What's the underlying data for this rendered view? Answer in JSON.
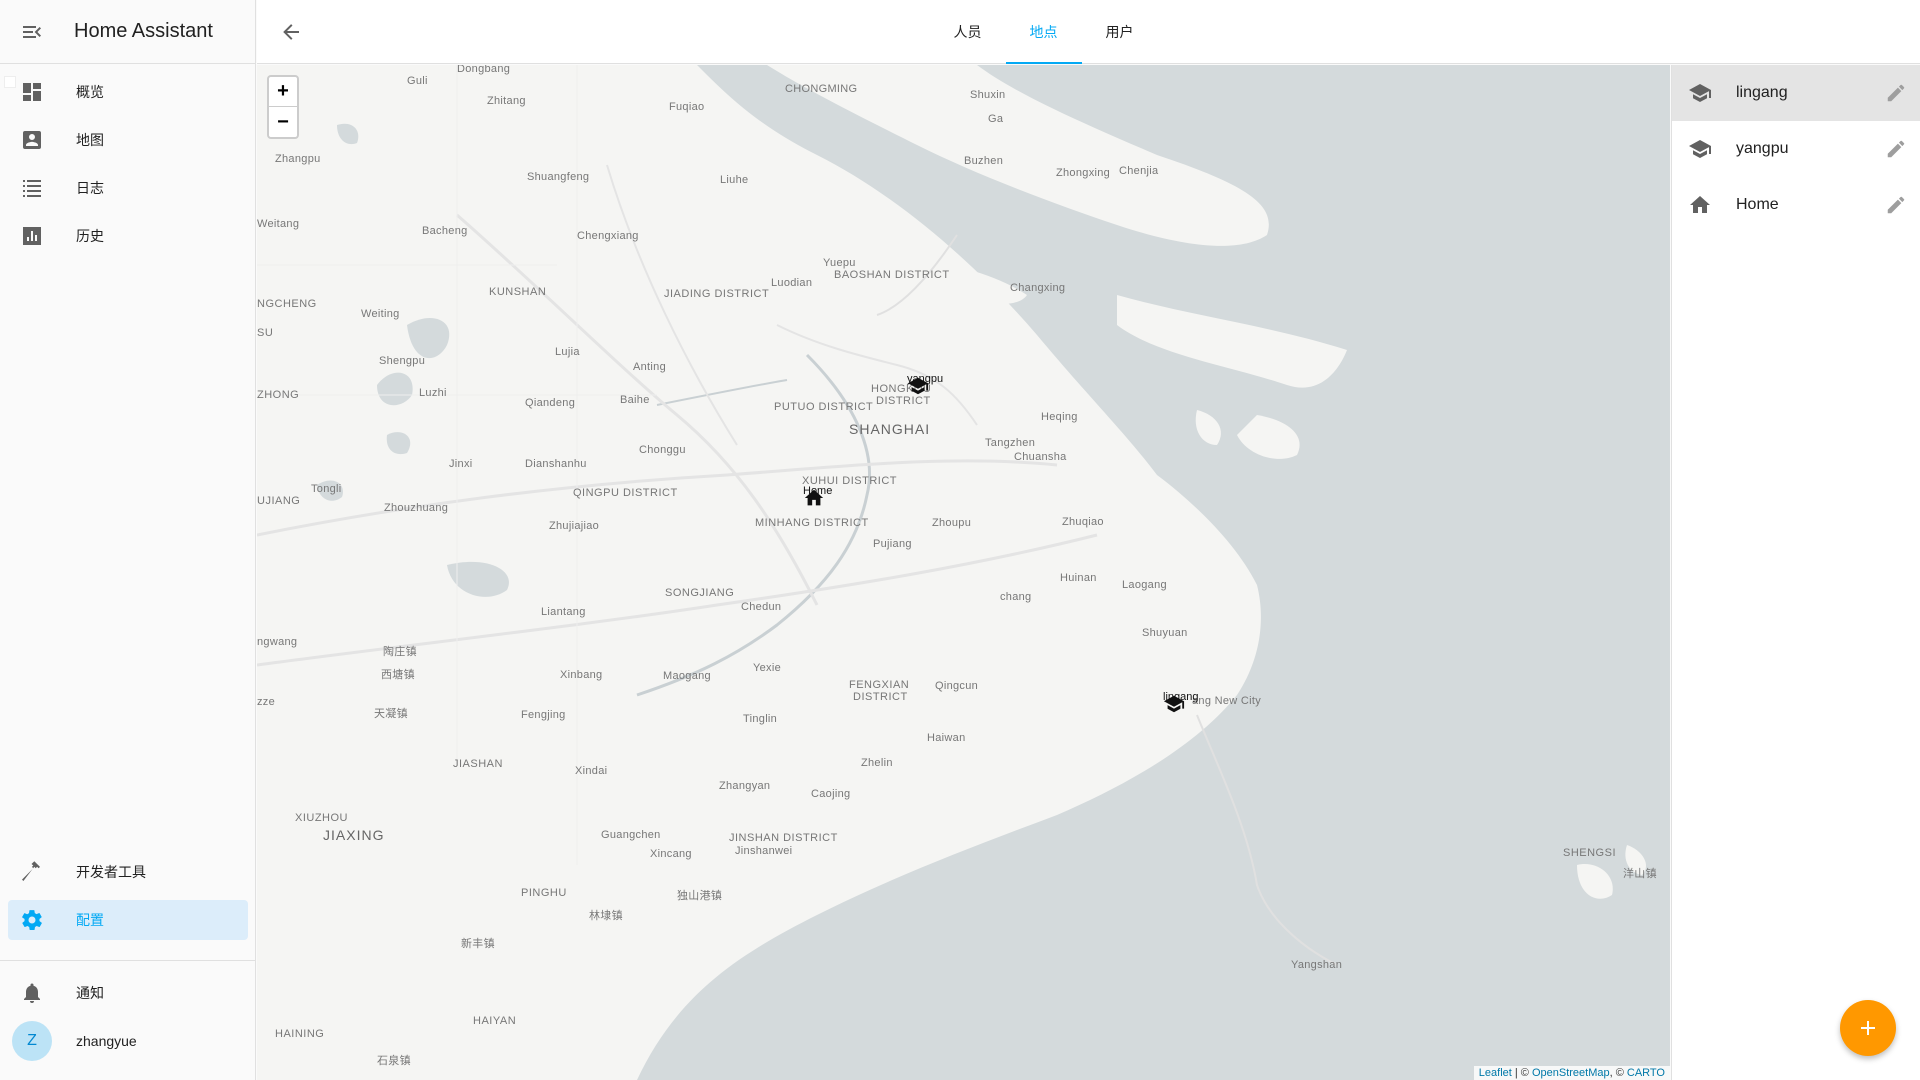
{
  "app": {
    "title": "Home Assistant"
  },
  "sidebar": {
    "items": [
      {
        "label": "概览",
        "icon": "dashboard-icon"
      },
      {
        "label": "地图",
        "icon": "map-account-icon"
      },
      {
        "label": "日志",
        "icon": "logbook-list-icon"
      },
      {
        "label": "历史",
        "icon": "history-chart-icon"
      }
    ],
    "bottom_items": [
      {
        "label": "开发者工具",
        "icon": "hammer-icon"
      },
      {
        "label": "配置",
        "icon": "gear-icon",
        "active": true
      },
      {
        "label": "通知",
        "icon": "bell-icon"
      }
    ],
    "user": {
      "name": "zhangyue",
      "initial": "Z"
    }
  },
  "topbar": {
    "tabs": [
      {
        "label": "人员"
      },
      {
        "label": "地点",
        "active": true
      },
      {
        "label": "用户"
      }
    ]
  },
  "map": {
    "zoom_in": "+",
    "zoom_out": "−",
    "labels": {
      "chongming": "CHONGMING",
      "shuxin": "Shuxin",
      "ga": "Ga",
      "buzhen": "Buzhen",
      "zhongxing": "Zhongxing",
      "chenjia": "Chenjia",
      "dongbang": "Dongbang",
      "guli": "Guli",
      "zhitang": "Zhitang",
      "fuqiao": "Fuqiao",
      "zhangpu": "Zhangpu",
      "shuangfeng": "Shuangfeng",
      "liuhe": "Liuhe",
      "weitang": "Weitang",
      "bacheng": "Bacheng",
      "chengxiang": "Chengxiang",
      "yuepu": "Yuepu",
      "baoshan": "BAOSHAN DISTRICT",
      "luodian": "Luodian",
      "changxing": "Changxing",
      "kunshan": "KUNSHAN",
      "jiading": "JIADING DISTRICT",
      "ncheng": "NGCHENG",
      "weiting": "Weiting",
      "su": "SU",
      "lujia": "Lujia",
      "anting": "Anting",
      "shengpu": "Shengpu",
      "zhong": "ZHONG",
      "luzhi": "Luzhi",
      "qiandeng": "Qiandeng",
      "baihe": "Baihe",
      "putuo": "PUTUO DISTRICT",
      "hongkou": "HONGKOU",
      "hongkou2": "DISTRICT",
      "shanghai": "SHANGHAI",
      "heqing": "Heqing",
      "tangzhen": "Tangzhen",
      "chuansha": "Chuansha",
      "jinxi": "Jinxi",
      "dianshanhu": "Dianshanhu",
      "chonggu": "Chonggu",
      "tongli": "Tongli",
      "uijiang": "UJIANG",
      "zhouzhuang": "Zhouzhuang",
      "qingpu": "QINGPU DISTRICT",
      "zhujiajiao": "Zhujiajiao",
      "xuhui": "XUHUI DISTRICT",
      "minhang": "MINHANG DISTRICT",
      "zhoupu": "Zhoupu",
      "zhuqiao": "Zhuqiao",
      "pujiang": "Pujiang",
      "huinan": "Huinan",
      "laogang": "Laogang",
      "chang": "chang",
      "songjiang": "SONGJIANG",
      "chedun": "Chedun",
      "liantang": "Liantang",
      "shuyuan": "Shuyuan",
      "ngwang": "ngwang",
      "xitang": "西塘镇",
      "xinbang": "Xinbang",
      "maogang": "Maogang",
      "yexie": "Yexie",
      "taozhuang": "陶庄镇",
      "fengxian": "FENGXIAN",
      "fengxian2": "DISTRICT",
      "qingcun": "Qingcun",
      "zze": "zze",
      "tianning": "天凝镇",
      "fengjing": "Fengjing",
      "tinglin": "Tinglin",
      "haiwan": "Haiwan",
      "jiashan": "JIASHAN",
      "xindai": "Xindai",
      "zhelin": "Zhelin",
      "zhangyan": "Zhangyan",
      "caojing": "Caojing",
      "xiuzhou": "XIUZHOU",
      "jiaxing": "JIAXING",
      "guangchen": "Guangchen",
      "jinshan": "JINSHAN DISTRICT",
      "jinshanwei": "Jinshanwei",
      "xincang": "Xincang",
      "dushan": "独山港镇",
      "pinghu": "PINGHU",
      "linbu": "林埭镇",
      "xinfeng": "新丰镇",
      "yangshan": "Yangshan",
      "shengsi": "SHENGSI",
      "haiyan": "HAIYAN",
      "haining": "HAINING",
      "shicang": "石泉镇",
      "newcity": "ang New City",
      "yangtai": "洋山镇"
    },
    "markers": [
      {
        "name": "yangpu",
        "icon": "school-icon"
      },
      {
        "name": "Home",
        "icon": "home-icon"
      },
      {
        "name": "lingang",
        "icon": "school-icon"
      }
    ],
    "attribution": {
      "leaflet": "Leaflet",
      "sep1": " | © ",
      "osm": "OpenStreetMap",
      "sep2": ", © ",
      "carto": "CARTO"
    }
  },
  "zones": [
    {
      "name": "lingang",
      "icon": "school-icon",
      "selected": true
    },
    {
      "name": "yangpu",
      "icon": "school-icon"
    },
    {
      "name": "Home",
      "icon": "home-icon"
    }
  ],
  "fab": {
    "icon": "plus-icon"
  },
  "colors": {
    "accent": "#03a9f4",
    "fab": "#ff9800",
    "active_bg": "#dcedfa"
  }
}
